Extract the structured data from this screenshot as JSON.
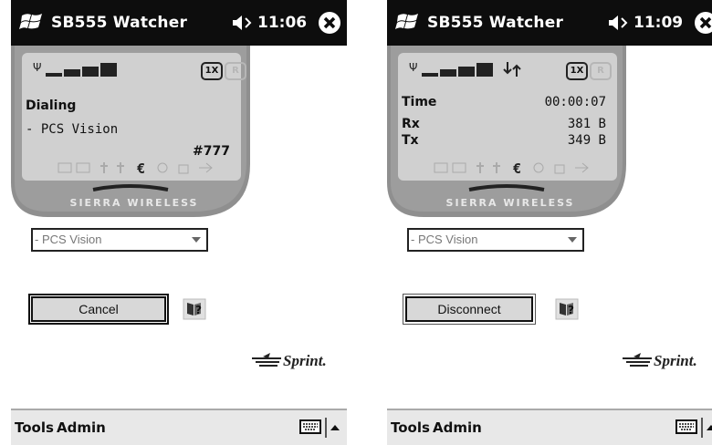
{
  "screens": [
    {
      "title": "SB555 Watcher",
      "time": "11:06",
      "badge_1x": "1X",
      "badge_r": "R",
      "status": "Dialing",
      "connection_name": "- PCS Vision",
      "number": "#777",
      "brand": "SIERRA WIRELESS",
      "dropdown_value": "- PCS Vision",
      "button_label": "Cancel",
      "carrier": "Sprint.",
      "menu_tools": "Tools",
      "menu_admin": "Admin"
    },
    {
      "title": "SB555 Watcher",
      "time": "11:09",
      "badge_1x": "1X",
      "badge_r": "R",
      "time_label": "Time",
      "time_value": "00:00:07",
      "rx_label": "Rx",
      "rx_value": "381 B",
      "tx_label": "Tx",
      "tx_value": "349 B",
      "brand": "SIERRA WIRELESS",
      "dropdown_value": "- PCS Vision",
      "button_label": "Disconnect",
      "carrier": "Sprint.",
      "menu_tools": "Tools",
      "menu_admin": "Admin"
    }
  ],
  "colors": {
    "titlebar": "#0d0d0d",
    "lcd": "#d0d0d0",
    "device_body": "#8f8f8f"
  }
}
